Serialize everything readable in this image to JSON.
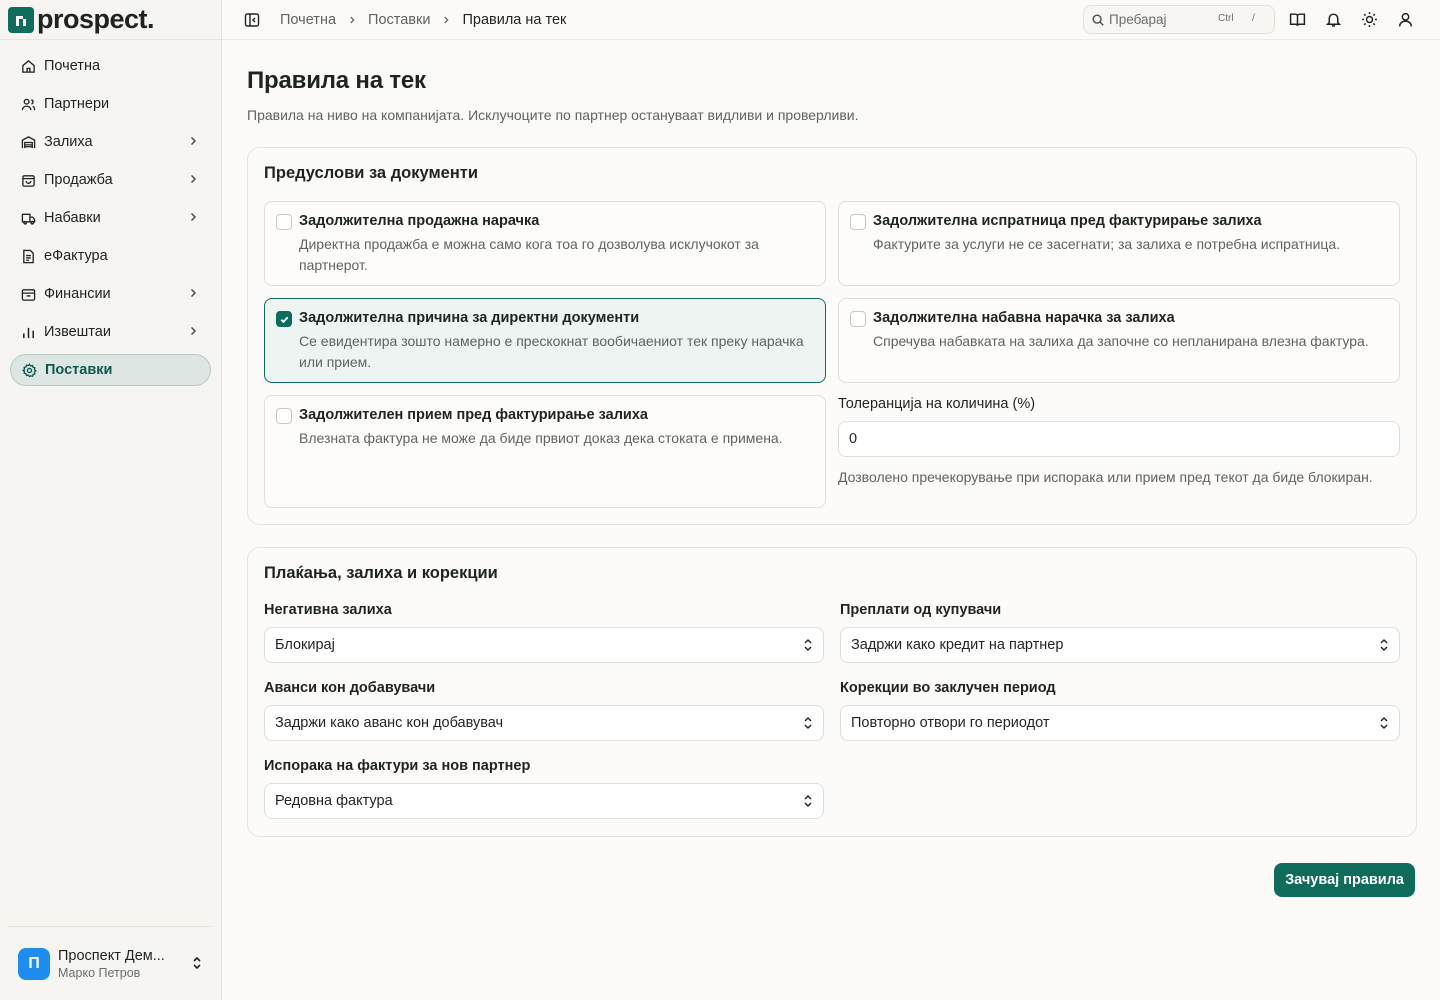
{
  "brand": {
    "name": "prospect."
  },
  "sidebar": {
    "items": [
      {
        "label": "Почетна",
        "icon": "home-icon",
        "chevron": false,
        "active": false
      },
      {
        "label": "Партнери",
        "icon": "users-icon",
        "chevron": false,
        "active": false
      },
      {
        "label": "Залиха",
        "icon": "warehouse-icon",
        "chevron": true,
        "active": false
      },
      {
        "label": "Продажба",
        "icon": "shopping-bag-icon",
        "chevron": true,
        "active": false
      },
      {
        "label": "Набавки",
        "icon": "truck-icon",
        "chevron": true,
        "active": false
      },
      {
        "label": "еФактура",
        "icon": "document-icon",
        "chevron": false,
        "active": false
      },
      {
        "label": "Финансии",
        "icon": "wallet-icon",
        "chevron": true,
        "active": false
      },
      {
        "label": "Извештаи",
        "icon": "bar-chart-icon",
        "chevron": true,
        "active": false
      },
      {
        "label": "Поставки",
        "icon": "gear-icon",
        "chevron": false,
        "active": true
      }
    ],
    "user": {
      "initial": "П",
      "company": "Проспект Дем...",
      "name": "Марко Петров"
    }
  },
  "topbar": {
    "breadcrumb": [
      "Почетна",
      "Поставки",
      "Правила на тек"
    ],
    "search": {
      "placeholder": "Пребарај",
      "kbd_mod": "Ctrl",
      "kbd_key": "/"
    }
  },
  "page": {
    "title": "Правила на тек",
    "subtitle": "Правила на ниво на компанијата. Исклучоците по партнер остануваат видливи и проверливи."
  },
  "prereq": {
    "title": "Предуслови за документи",
    "options": [
      {
        "title": "Задолжителна продажна нарачка",
        "desc": "Директна продажба е можна само кога тоа го дозволува исклучокот за партнерот.",
        "checked": false
      },
      {
        "title": "Задолжителна испратница пред фактурирање залиха",
        "desc": "Фактурите за услуги не се засегнати; за залиха е потребна испратница.",
        "checked": false
      },
      {
        "title": "Задолжителна причина за директни документи",
        "desc": "Се евидентира зошто намерно е прескокнат вообичаениот тек преку нарачка или прием.",
        "checked": true
      },
      {
        "title": "Задолжителна набавна нарачка за залиха",
        "desc": "Спречува набавката на залиха да започне со непланирана влезна фактура.",
        "checked": false
      },
      {
        "title": "Задолжителен прием пред фактурирање залиха",
        "desc": "Влезната фактура не може да биде првиот доказ дека стоката е примена.",
        "checked": false
      }
    ],
    "tolerance": {
      "label": "Толеранција на количина (%)",
      "value": "0",
      "help": "Дозволено пречекорување при испорака или прием пред текот да биде блокиран."
    }
  },
  "payments": {
    "title": "Плаќања, залиха и корекции",
    "fields": [
      {
        "label": "Негативна залиха",
        "value": "Блокирај"
      },
      {
        "label": "Преплати од купувачи",
        "value": "Задржи како кредит на партнер"
      },
      {
        "label": "Аванси кон добавувачи",
        "value": "Задржи како аванс кон добавувач"
      },
      {
        "label": "Корекции во заклучен период",
        "value": "Повторно отвори го периодот"
      },
      {
        "label": "Испорака на фактури за нов партнер",
        "value": "Редовна фактура"
      }
    ]
  },
  "actions": {
    "save_label": "Зачувај правила"
  },
  "colors": {
    "accent": "#0f6b5c",
    "avatar": "#1d8ef0"
  }
}
